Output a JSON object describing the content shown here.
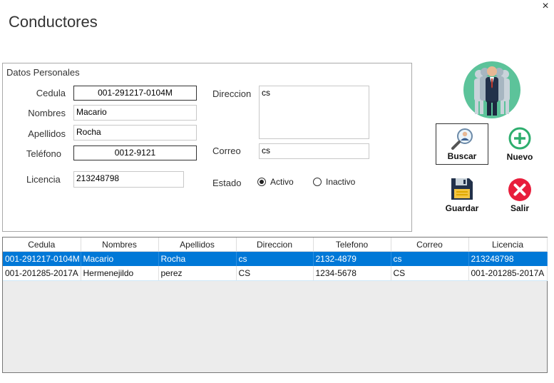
{
  "window": {
    "title": "Conductores",
    "close_glyph": "×"
  },
  "personal": {
    "group_label": "Datos Personales",
    "cedula": {
      "label": "Cedula",
      "value": "001-291217-0104M"
    },
    "nombres": {
      "label": "Nombres",
      "value": "Macario"
    },
    "apellidos": {
      "label": "Apellidos",
      "value": "Rocha"
    },
    "telefono": {
      "label": "Teléfono",
      "value": "0012-9121"
    },
    "licencia": {
      "label": "Licencia",
      "value": "213248798"
    },
    "direccion": {
      "label": "Direccion",
      "value": "cs"
    },
    "correo": {
      "label": "Correo",
      "value": "cs"
    },
    "estado": {
      "label": "Estado",
      "options": [
        {
          "label": "Activo",
          "selected": true
        },
        {
          "label": "Inactivo",
          "selected": false
        }
      ]
    }
  },
  "actions": {
    "buscar": "Buscar",
    "nuevo": "Nuevo",
    "guardar": "Guardar",
    "salir": "Salir",
    "icons": [
      "people-group-icon",
      "search-user-icon",
      "add-circle-icon",
      "save-disk-icon",
      "close-circle-icon"
    ]
  },
  "table": {
    "columns": [
      "Cedula",
      "Nombres",
      "Apellidos",
      "Direccion",
      "Telefono",
      "Correo",
      "Licencia"
    ],
    "rows": [
      {
        "selected": true,
        "cells": [
          "001-291217-0104M",
          "Macario",
          "Rocha",
          "cs",
          "2132-4879",
          "cs",
          "213248798"
        ]
      },
      {
        "selected": false,
        "cells": [
          "001-201285-2017A",
          "Hermenejildo",
          "perez",
          "CS",
          "1234-5678",
          "CS",
          "001-201285-2017A"
        ]
      }
    ]
  },
  "colors": {
    "selection": "#0078d7",
    "accent_green": "#2eae6e",
    "close_red": "#e81e3c"
  }
}
